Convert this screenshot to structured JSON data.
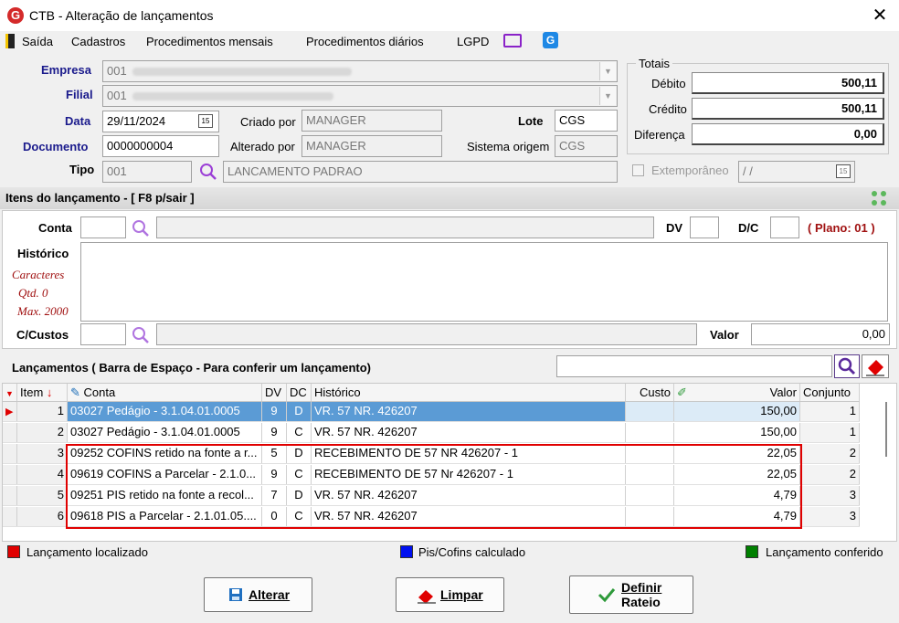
{
  "window": {
    "title": "CTB - Alteração de lançamentos",
    "app_letter": "G"
  },
  "menu": {
    "items": [
      "Saída",
      "Cadastros",
      "Procedimentos mensais",
      "Procedimentos diários",
      "LGPD"
    ]
  },
  "header": {
    "empresa_label": "Empresa",
    "empresa_value": "001",
    "filial_label": "Filial",
    "filial_value": "001",
    "data_label": "Data",
    "data_value": "29/11/2024",
    "documento_label": "Documento",
    "documento_value": "0000000004",
    "tipo_label": "Tipo",
    "tipo_value": "001",
    "tipo_desc": "LANCAMENTO PADRAO",
    "criado_label": "Criado por",
    "criado_value": "MANAGER",
    "alterado_label": "Alterado por",
    "alterado_value": "MANAGER",
    "lote_label": "Lote",
    "lote_value": "CGS",
    "sistema_label": "Sistema origem",
    "sistema_value": "CGS",
    "calendar_glyph": "15"
  },
  "totais": {
    "title": "Totais",
    "debito_label": "Débito",
    "debito_value": "500,11",
    "credito_label": "Crédito",
    "credito_value": "500,11",
    "diferenca_label": "Diferença",
    "diferenca_value": "0,00",
    "extemp_label": "Extemporâneo",
    "extemp_date": " /  /"
  },
  "itens": {
    "section_title": "Itens do lançamento - [ F8 p/sair ]",
    "conta_label": "Conta",
    "dv_label": "DV",
    "dc_label": "D/C",
    "plano_text": "( Plano: 01 )",
    "historico_label": "Histórico",
    "caracteres_label": "Caracteres",
    "qtd_label": "Qtd. 0",
    "max_label": "Max. 2000",
    "ccustos_label": "C/Custos",
    "valor_label": "Valor",
    "valor_value": "0,00"
  },
  "lancamentos": {
    "title": "Lançamentos ( Barra de Espaço - Para conferir um lançamento)",
    "columns": [
      "Item",
      "Conta",
      "DV",
      "DC",
      "Histórico",
      "Custo",
      "Valor",
      "Conjunto"
    ],
    "rows": [
      {
        "item": "1",
        "conta": "03027 Pedágio - 3.1.04.01.0005",
        "dv": "9",
        "dc": "D",
        "historico": "VR. 57 NR. 426207",
        "custo": "",
        "valor": "150,00",
        "conjunto": "1"
      },
      {
        "item": "2",
        "conta": "03027 Pedágio - 3.1.04.01.0005",
        "dv": "9",
        "dc": "C",
        "historico": "VR. 57 NR. 426207",
        "custo": "",
        "valor": "150,00",
        "conjunto": "1"
      },
      {
        "item": "3",
        "conta": "09252 COFINS retido na fonte a r...",
        "dv": "5",
        "dc": "D",
        "historico": "RECEBIMENTO DE 57 NR 426207 - 1",
        "custo": "",
        "valor": "22,05",
        "conjunto": "2"
      },
      {
        "item": "4",
        "conta": "09619 COFINS a Parcelar - 2.1.0...",
        "dv": "9",
        "dc": "C",
        "historico": "RECEBIMENTO DE 57 Nr 426207 - 1",
        "custo": "",
        "valor": "22,05",
        "conjunto": "2"
      },
      {
        "item": "5",
        "conta": "09251 PIS retido na fonte a recol...",
        "dv": "7",
        "dc": "D",
        "historico": "VR. 57 NR. 426207",
        "custo": "",
        "valor": "4,79",
        "conjunto": "3"
      },
      {
        "item": "6",
        "conta": "09618 PIS a Parcelar - 2.1.01.05....",
        "dv": "0",
        "dc": "C",
        "historico": "VR. 57 NR. 426207",
        "custo": "",
        "valor": "4,79",
        "conjunto": "3"
      }
    ]
  },
  "legend": {
    "localizado": "Lançamento localizado",
    "localizado_color": "#e00000",
    "piscofins": "Pis/Cofins calculado",
    "piscofins_color": "#0010f0",
    "conferido": "Lançamento conferido",
    "conferido_color": "#008000"
  },
  "buttons": {
    "alterar": "Alterar",
    "limpar": "Limpar",
    "definir1": "Definir",
    "definir2": "Rateio"
  },
  "colors": {
    "selected_row": "#5b9bd5",
    "highlight_box": "#e00000",
    "label_blue": "#1a1a8c",
    "plano_red": "#a01010"
  }
}
